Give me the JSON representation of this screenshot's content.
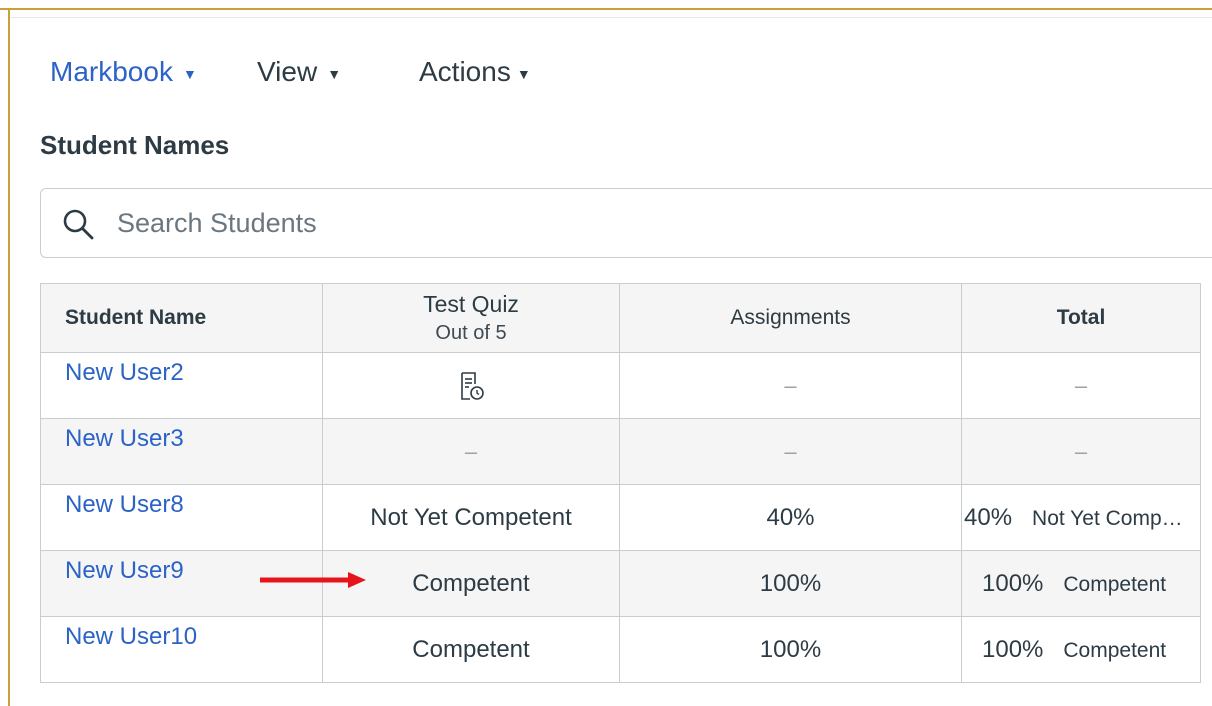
{
  "menu": {
    "markbook": "Markbook",
    "view": "View",
    "actions": "Actions"
  },
  "section_title": "Student Names",
  "search": {
    "placeholder": "Search Students",
    "icon": "search-icon"
  },
  "table": {
    "headers": {
      "student_name": "Student Name",
      "test_quiz": "Test Quiz",
      "test_quiz_sub": "Out of 5",
      "assignments": "Assignments",
      "total": "Total"
    },
    "rows": [
      {
        "name": "New User2",
        "quiz": "",
        "quiz_icon": "submitted-quiz-icon",
        "assignments": "–",
        "total_pct": "–",
        "total_label": ""
      },
      {
        "name": "New User3",
        "quiz": "–",
        "assignments": "–",
        "total_pct": "–",
        "total_label": ""
      },
      {
        "name": "New User8",
        "quiz": "Not Yet Competent",
        "assignments": "40%",
        "total_pct": "40%",
        "total_label": "Not Yet Comp…"
      },
      {
        "name": "New User9",
        "quiz": "Competent",
        "assignments": "100%",
        "total_pct": "100%",
        "total_label": "Competent"
      },
      {
        "name": "New User10",
        "quiz": "Competent",
        "assignments": "100%",
        "total_pct": "100%",
        "total_label": "Competent"
      }
    ]
  },
  "colors": {
    "link": "#2b63c6",
    "frame": "#c9a13a",
    "annotation_arrow": "#e8141b",
    "text": "#2d3b45"
  }
}
